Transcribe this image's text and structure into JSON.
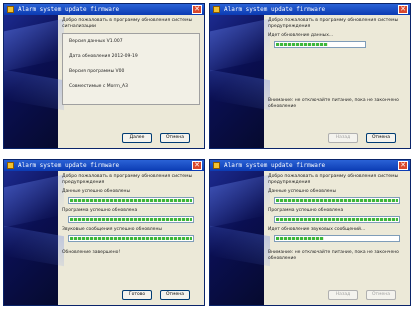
{
  "window_title": "Alarm system update firmware",
  "panel1": {
    "heading": "Добро пожаловать в программу обновления системы сигнализации",
    "info": [
      "Версия данных V1.007",
      "Дата обновления 2012-09-19",
      "Версия программы V00",
      "Совместимые с Morrn_A3"
    ],
    "next_button": "Далее",
    "cancel_button": "Отмена"
  },
  "panel2": {
    "heading": "Добро пожаловать в программу обновления системы предупреждения",
    "status": "Идет обновление данных...",
    "progress": 0.6,
    "note": "Внимание: не отключайте питание, пока не закончено обновление",
    "back_button": "Назад",
    "cancel_button": "Отмена"
  },
  "panel3": {
    "heading": "Добро пожаловать в программу обновления системы предупреждения",
    "lines": [
      "Данные успешно обновлены",
      "Программа успешно обновлена",
      "Звуковые сообщения успешно обновлены"
    ],
    "progress": [
      1.0,
      1.0,
      1.0
    ],
    "done": "Обновление завершено!",
    "finish_button": "Готово",
    "cancel_button": "Отмена"
  },
  "panel4": {
    "heading": "Добро пожаловать в программу обновления системы предупреждения",
    "lines": [
      "Данные успешно обновлены",
      "Программа успешно обновлена",
      "Идет обновление звуковых сообщений..."
    ],
    "progress": [
      1.0,
      1.0,
      0.4
    ],
    "note": "Внимание: не отключайте питание, пока не закончено обновление",
    "back_button": "Назад",
    "cancel_button": "Отмена"
  }
}
